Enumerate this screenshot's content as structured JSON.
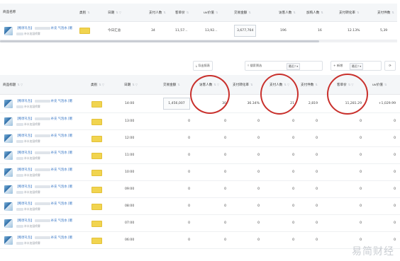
{
  "top_table": {
    "headers": [
      {
        "label": "商品名称",
        "arrows": ""
      },
      {
        "label": "类别",
        "arrows": "⇅"
      },
      {
        "label": "日期",
        "arrows": "⇅ ▽"
      },
      {
        "label": "支付人数",
        "arrows": "⇅"
      },
      {
        "label": "客单价",
        "arrows": "⇅"
      },
      {
        "label": "uv价值",
        "arrows": "⇅"
      },
      {
        "label": "交易金额",
        "arrows": "⇅"
      },
      {
        "label": "访客人数",
        "arrows": "⇅"
      },
      {
        "label": "加购人数",
        "arrows": "⇅"
      },
      {
        "label": "支付转化率",
        "arrows": "⇅"
      },
      {
        "label": "支付件数",
        "arrows": "⇅"
      }
    ],
    "row": {
      "title": "【畅享礼包】",
      "title_suffix": "补充 气泡水 [赠",
      "subtitle": "补水加湿喷雾",
      "date": "今日汇总",
      "pay_users": "34",
      "unit_price": "11,57...",
      "uv_value": "13,92...",
      "amount": "3,677,764",
      "visitors": "196",
      "cart_users": "16",
      "conversion": "12.13%",
      "pay_items": "5,39"
    }
  },
  "toolbar": {
    "export_label": "导出报表",
    "search_label": "商品筛选",
    "filter_label": "搜索筛选",
    "filter_select": "最近7",
    "add_label": "+ 新增",
    "add_select": "最近7",
    "refresh_icon": "refresh-icon"
  },
  "main_table": {
    "headers": [
      {
        "label": "商品标题",
        "arrows": "⇅ ▽"
      },
      {
        "label": "类别",
        "arrows": "⇅ ▽"
      },
      {
        "label": "日期",
        "arrows": "⇅ ▽"
      },
      {
        "label": "交易金额",
        "arrows": "⇅"
      },
      {
        "label": "访客人数",
        "arrows": "⇅ ▽"
      },
      {
        "label": "支付转化率",
        "arrows": "⇅"
      },
      {
        "label": "支付人数",
        "arrows": "⇅ ▽"
      },
      {
        "label": "支付件数",
        "arrows": "⇅"
      },
      {
        "label": "客单价",
        "arrows": "⇅ ▽"
      },
      {
        "label": "uv价值",
        "arrows": "⇅"
      }
    ],
    "product": {
      "title": "【畅享礼包】",
      "title_suffix": "补充 气泡水 [赠",
      "subtitle": "补水加湿喷雾"
    },
    "rows": [
      {
        "date": "14:00",
        "amount": "1,456,007",
        "visitors": "30",
        "conversion": "36.34%",
        "pay_users": "21",
        "pay_items": "2,819",
        "unit_price": "11,281.29",
        "uv_value": "+1,029.99"
      },
      {
        "date": "13:00",
        "amount": "0",
        "visitors": "0",
        "conversion": "0",
        "pay_users": "0",
        "pay_items": "0",
        "unit_price": "0",
        "uv_value": "0"
      },
      {
        "date": "12:00",
        "amount": "0",
        "visitors": "0",
        "conversion": "0",
        "pay_users": "0",
        "pay_items": "0",
        "unit_price": "0",
        "uv_value": "0"
      },
      {
        "date": "11:00",
        "amount": "0",
        "visitors": "0",
        "conversion": "0",
        "pay_users": "0",
        "pay_items": "0",
        "unit_price": "0",
        "uv_value": "0"
      },
      {
        "date": "10:00",
        "amount": "0",
        "visitors": "0",
        "conversion": "0",
        "pay_users": "0",
        "pay_items": "0",
        "unit_price": "0",
        "uv_value": "0"
      },
      {
        "date": "09:00",
        "amount": "0",
        "visitors": "0",
        "conversion": "0",
        "pay_users": "0",
        "pay_items": "0",
        "unit_price": "0",
        "uv_value": "0"
      },
      {
        "date": "08:00",
        "amount": "0",
        "visitors": "0",
        "conversion": "0",
        "pay_users": "0",
        "pay_items": "0",
        "unit_price": "0",
        "uv_value": "0"
      },
      {
        "date": "07:00",
        "amount": "0",
        "visitors": "0",
        "conversion": "0",
        "pay_users": "0",
        "pay_items": "0",
        "unit_price": "0",
        "uv_value": "0"
      },
      {
        "date": "06:00",
        "amount": "0",
        "visitors": "0",
        "conversion": "0",
        "pay_users": "0",
        "pay_items": "0",
        "unit_price": "0",
        "uv_value": "0"
      }
    ]
  },
  "watermark": "易简财经",
  "colors": {
    "accent_red": "#c9302c",
    "tag_yellow": "#f1d44f",
    "link_blue": "#2d6fc2",
    "header_bg": "#f4f6f8"
  }
}
